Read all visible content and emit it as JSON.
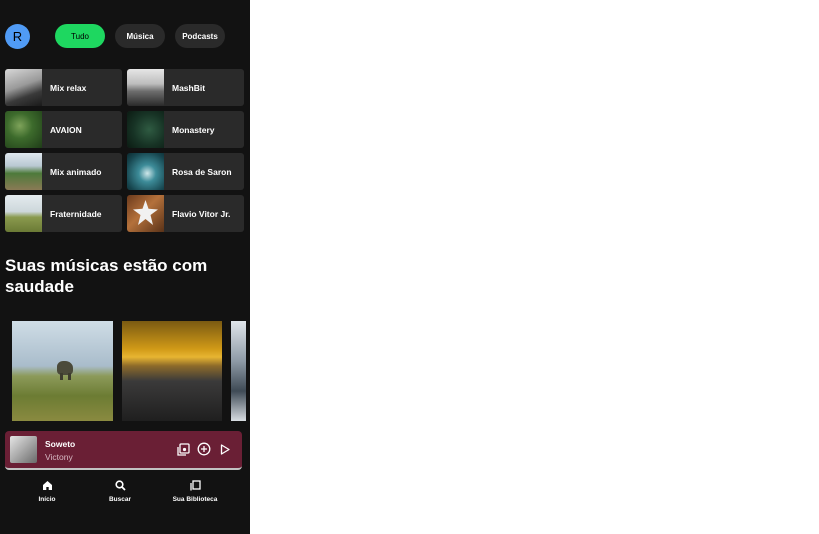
{
  "header": {
    "avatar_initial": "R",
    "chips": [
      {
        "label": "Tudo",
        "active": true
      },
      {
        "label": "Música",
        "active": false
      },
      {
        "label": "Podcasts",
        "active": false
      }
    ]
  },
  "shortcuts": [
    {
      "label": "Mix relax"
    },
    {
      "label": "MashBit"
    },
    {
      "label": "AVAION"
    },
    {
      "label": "Monastery"
    },
    {
      "label": "Mix animado"
    },
    {
      "label": "Rosa de Saron"
    },
    {
      "label": "Fraternidade"
    },
    {
      "label": "Flavio Vitor Jr."
    }
  ],
  "section": {
    "title": "Suas músicas estão com saudade"
  },
  "now_playing": {
    "title": "Soweto",
    "artist": "Victony"
  },
  "bottom_nav": {
    "home": "Início",
    "search": "Buscar",
    "library": "Sua Biblioteca"
  },
  "colors": {
    "accent": "#1ed760",
    "background": "#121212",
    "tile": "#2a2a2a",
    "player": "#6a1f35"
  }
}
